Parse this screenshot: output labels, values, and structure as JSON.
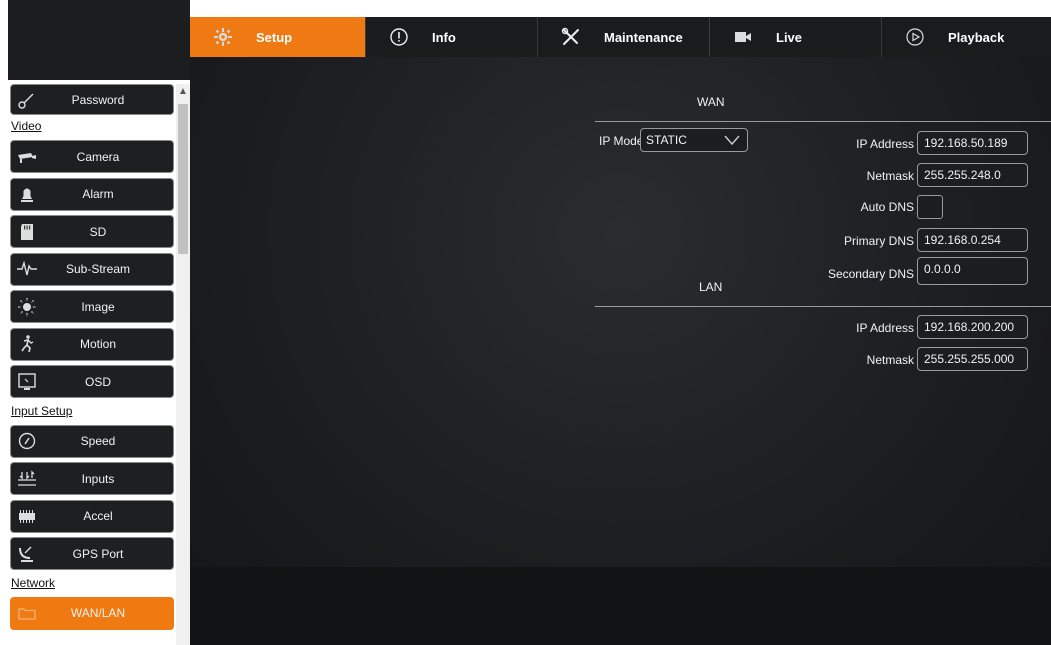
{
  "nav": {
    "tabs": [
      {
        "label": "Setup",
        "icon": "gear-icon",
        "active": true
      },
      {
        "label": "Info",
        "icon": "info-icon",
        "active": false
      },
      {
        "label": "Maintenance",
        "icon": "tools-icon",
        "active": false
      },
      {
        "label": "Live",
        "icon": "video-camera-icon",
        "active": false
      },
      {
        "label": "Playback",
        "icon": "play-circle-icon",
        "active": false
      }
    ]
  },
  "sidebar": {
    "password_label": "Password",
    "sections": {
      "video": "Video",
      "input_setup": "Input Setup",
      "network": "Network"
    },
    "video_items": [
      {
        "label": "Camera",
        "icon": "camera-icon"
      },
      {
        "label": "Alarm",
        "icon": "bell-icon"
      },
      {
        "label": "SD",
        "icon": "sd-card-icon"
      },
      {
        "label": "Sub-Stream",
        "icon": "waveform-icon"
      },
      {
        "label": "Image",
        "icon": "brightness-icon"
      },
      {
        "label": "Motion",
        "icon": "running-person-icon"
      },
      {
        "label": "OSD",
        "icon": "monitor-icon"
      }
    ],
    "input_items": [
      {
        "label": "Speed",
        "icon": "speedometer-icon"
      },
      {
        "label": "Inputs",
        "icon": "inputs-icon"
      },
      {
        "label": "Accel",
        "icon": "accel-icon"
      },
      {
        "label": "GPS Port",
        "icon": "satellite-icon"
      }
    ],
    "network_items": [
      {
        "label": "WAN/LAN",
        "icon": "folder-icon",
        "active": true
      }
    ]
  },
  "wan": {
    "title": "WAN",
    "ip_mode_label": "IP Mode",
    "ip_mode_value": "STATIC",
    "ip_address_label": "IP Address",
    "ip_address_value": "192.168.50.189",
    "netmask_label": "Netmask",
    "netmask_value": "255.255.248.0",
    "auto_dns_label": "Auto DNS",
    "auto_dns_checked": false,
    "primary_dns_label": "Primary DNS",
    "primary_dns_value": "192.168.0.254",
    "secondary_dns_label": "Secondary DNS",
    "secondary_dns_value": "0.0.0.0"
  },
  "lan": {
    "title": "LAN",
    "ip_address_label": "IP Address",
    "ip_address_value": "192.168.200.200",
    "netmask_label": "Netmask",
    "netmask_value": "255.255.255.000"
  },
  "colors": {
    "accent": "#ef7a14",
    "panel": "#1d1e21",
    "border": "#9a9a9a"
  }
}
